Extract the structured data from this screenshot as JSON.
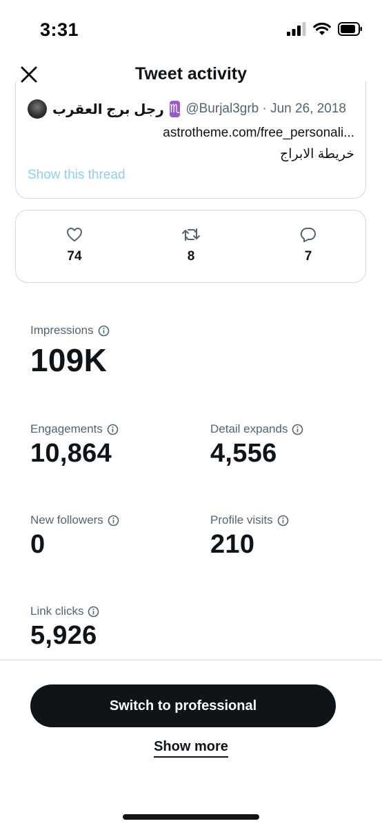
{
  "status_bar": {
    "time": "3:31"
  },
  "header": {
    "title": "Tweet activity"
  },
  "tweet": {
    "author_name": "رجل برج العقرب",
    "badge": "♏",
    "handle_date": "@Burjal3grb · Jun 26, 2018",
    "link_text": "astrotheme.com/free_personali...",
    "arabic_text": "خريطة الابراج",
    "show_thread": "Show this thread"
  },
  "engagement": {
    "likes": "74",
    "retweets": "8",
    "replies": "7"
  },
  "metrics": {
    "impressions": {
      "label": "Impressions",
      "value": "109K"
    },
    "engagements": {
      "label": "Engagements",
      "value": "10,864"
    },
    "detail_expands": {
      "label": "Detail expands",
      "value": "4,556"
    },
    "new_followers": {
      "label": "New followers",
      "value": "0"
    },
    "profile_visits": {
      "label": "Profile visits",
      "value": "210"
    },
    "link_clicks": {
      "label": "Link clicks",
      "value": "5,926"
    }
  },
  "actions": {
    "switch_pro": "Switch to professional",
    "show_more": "Show more"
  },
  "colors": {
    "text_primary": "#0f1419",
    "text_secondary": "#536471",
    "border": "#cfd9de",
    "link_light": "#8ecdf8",
    "badge_purple": "#9b59d0"
  }
}
